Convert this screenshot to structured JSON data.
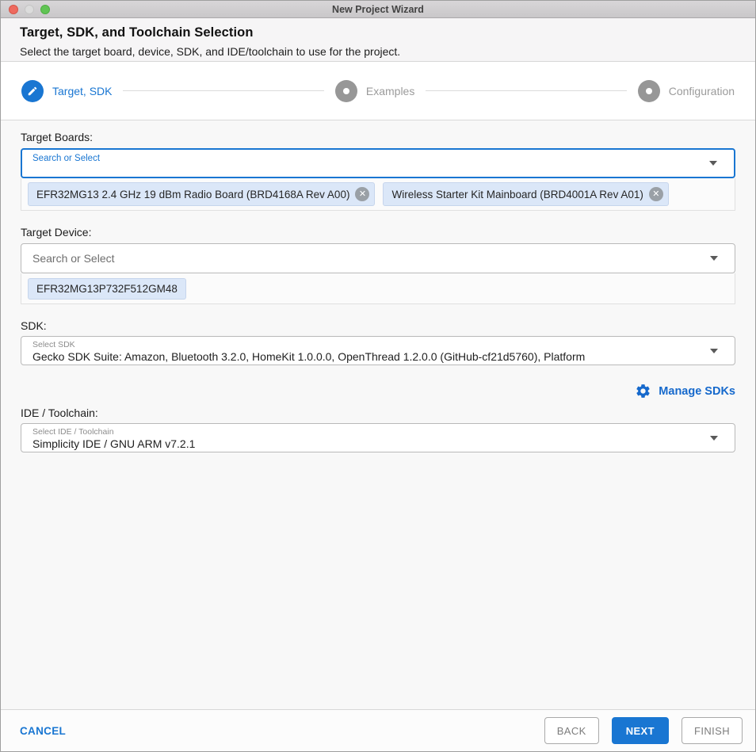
{
  "window": {
    "title": "New Project Wizard"
  },
  "header": {
    "title": "Target, SDK, and Toolchain Selection",
    "subtitle": "Select the target board, device, SDK, and IDE/toolchain to use for the project."
  },
  "stepper": {
    "steps": [
      {
        "label": "Target, SDK",
        "state": "active"
      },
      {
        "label": "Examples",
        "state": "pending"
      },
      {
        "label": "Configuration",
        "state": "pending"
      }
    ]
  },
  "target_boards": {
    "label": "Target Boards:",
    "placeholder": "Search or Select",
    "chips": [
      {
        "text": "EFR32MG13 2.4 GHz 19 dBm Radio Board (BRD4168A Rev A00)",
        "remove_glyph": "✕"
      },
      {
        "text": "Wireless Starter Kit Mainboard (BRD4001A Rev A01)",
        "remove_glyph": "✕"
      }
    ]
  },
  "target_device": {
    "label": "Target Device:",
    "placeholder": "Search or Select",
    "chips": [
      {
        "text": "EFR32MG13P732F512GM48"
      }
    ]
  },
  "sdk": {
    "label": "SDK:",
    "field_label": "Select SDK",
    "value": "Gecko SDK Suite: Amazon, Bluetooth 3.2.0, HomeKit 1.0.0.0, OpenThread 1.2.0.0 (GitHub-cf21d5760), Platform",
    "manage_label": "Manage SDKs"
  },
  "ide": {
    "label": "IDE / Toolchain:",
    "field_label": "Select IDE / Toolchain",
    "value": "Simplicity IDE / GNU ARM v7.2.1"
  },
  "footer": {
    "cancel": "CANCEL",
    "back": "BACK",
    "next": "NEXT",
    "finish": "FINISH"
  },
  "colors": {
    "accent": "#1976d2",
    "pending_gray": "#979797",
    "chip_bg": "#dbe7f8",
    "traffic_red": "#ee6a5f",
    "traffic_green": "#61c454"
  }
}
